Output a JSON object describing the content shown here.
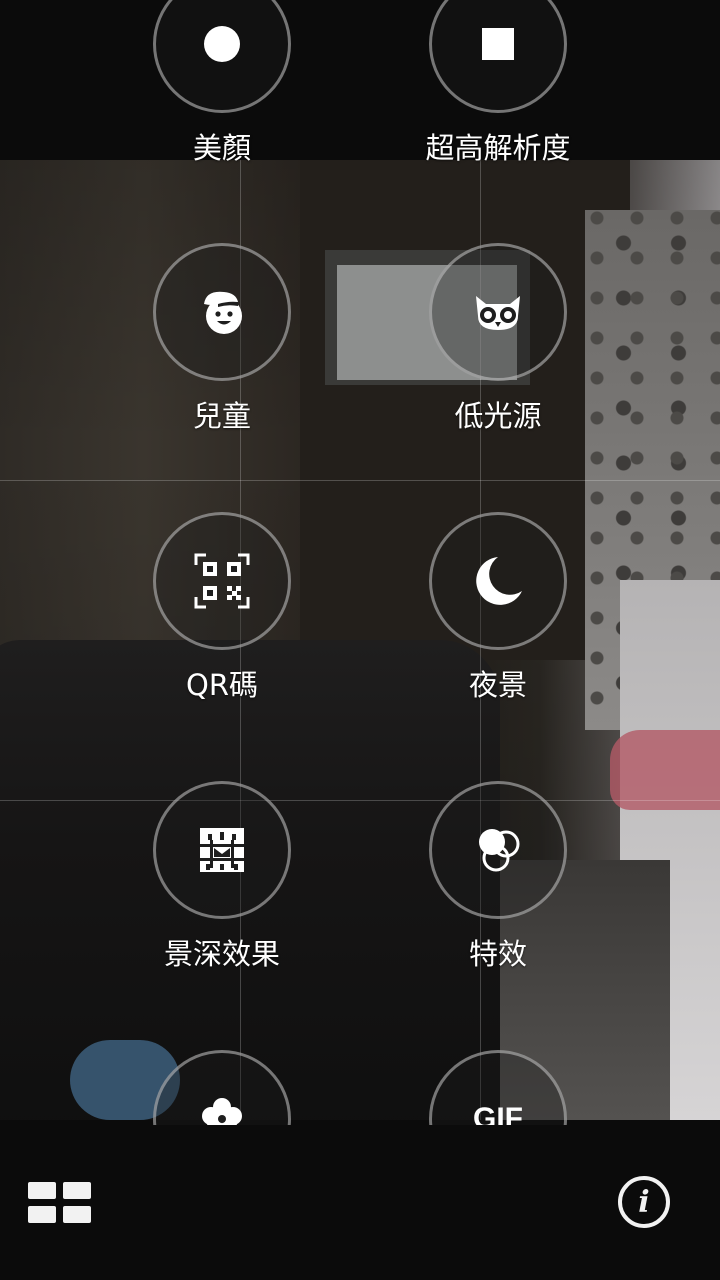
{
  "modes": [
    {
      "label": "美顏",
      "icon": "beauty-icon"
    },
    {
      "label": "超高解析度",
      "icon": "super-resolution-icon"
    },
    {
      "label": "兒童",
      "icon": "child-face-icon"
    },
    {
      "label": "低光源",
      "icon": "owl-icon"
    },
    {
      "label": "QR碼",
      "icon": "qr-code-icon"
    },
    {
      "label": "夜景",
      "icon": "moon-icon"
    },
    {
      "label": "景深效果",
      "icon": "depth-of-field-icon"
    },
    {
      "label": "特效",
      "icon": "effects-circles-icon"
    },
    {
      "label": "",
      "icon": "flower-icon"
    },
    {
      "label": "",
      "icon": "gif-icon",
      "icon_text": "GIF"
    }
  ],
  "bottom_bar": {
    "grid_icon": "grid-view-icon",
    "info_icon": "info-icon",
    "info_text": "i"
  },
  "colors": {
    "background": "#0b0b0b",
    "ring": "#c8c8c8",
    "icon": "#ffffff"
  }
}
